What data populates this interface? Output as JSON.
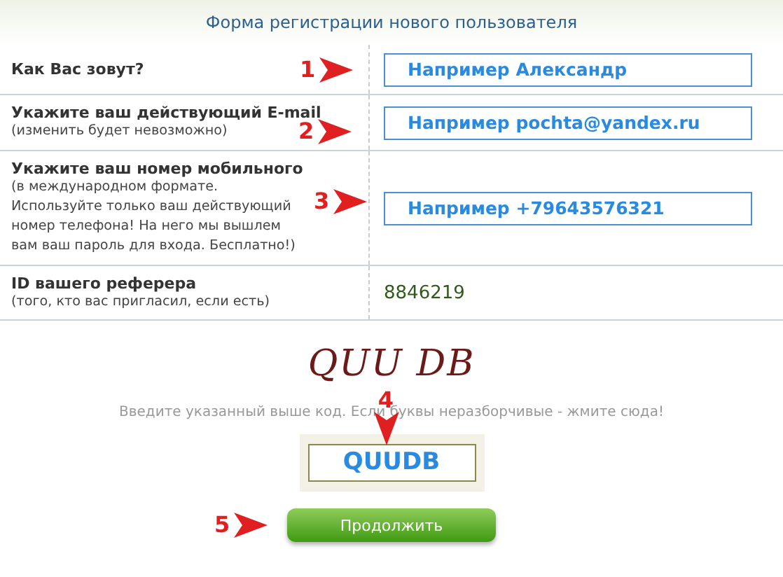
{
  "title": "Форма регистрации нового пользователя",
  "rows": [
    {
      "label": "Как Вас зовут?",
      "kind": "field",
      "value": "Например Александр",
      "marker": "1"
    },
    {
      "label": "Укажите ваш действующий E-mail",
      "hint": "(изменить будет невозможно)",
      "kind": "field",
      "value": "Например pochta@yandex.ru",
      "marker": "2"
    },
    {
      "label": "Укажите ваш номер мобильного",
      "hint": "(в международном формате. Используйте только ваш действующий номер телефона! На него мы вышлем вам ваш пароль для входа. Бесплатно!)",
      "kind": "field",
      "value": "Например +79643576321",
      "marker": "3"
    },
    {
      "label": "ID вашего реферера",
      "hint": "(того, кто вас пригласил, если есть)",
      "kind": "text",
      "value": "8846219"
    }
  ],
  "captcha": {
    "image_text": "QUU DB",
    "caption": "Введите указанный выше код. Если буквы неразборчивые - жмите сюда!",
    "value": "QUUDB",
    "marker": "4"
  },
  "submit": {
    "label": "Продолжить",
    "marker": "5"
  }
}
